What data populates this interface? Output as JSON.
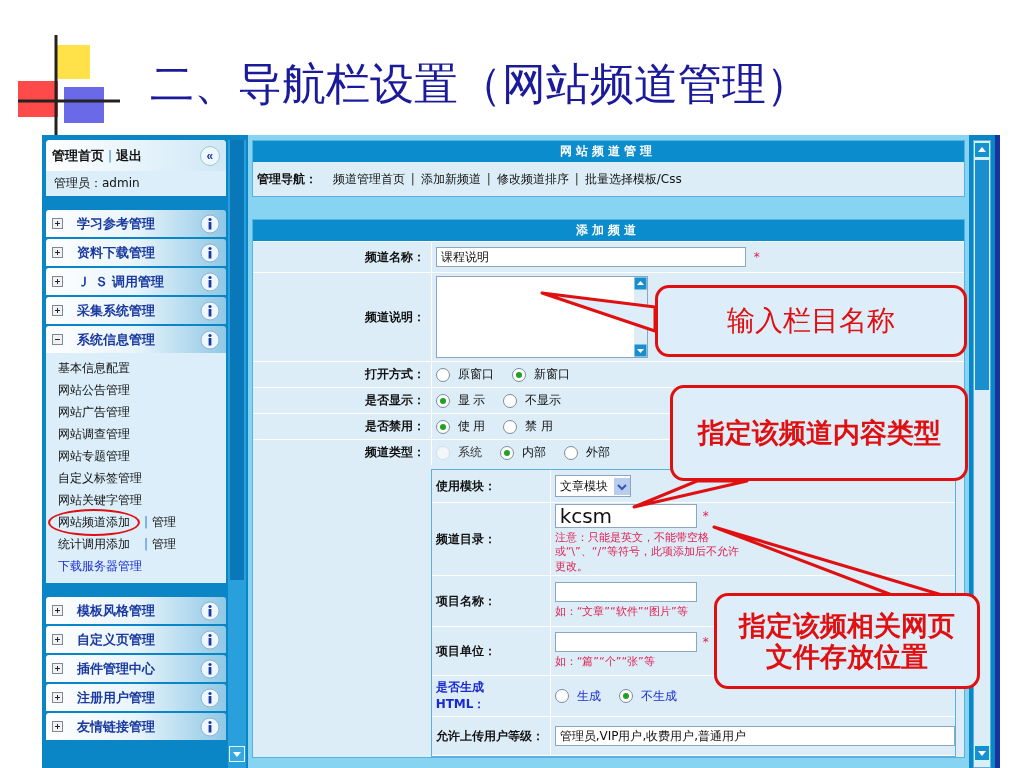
{
  "slide_title": "二、导航栏设置（网站频道管理）",
  "sidebar": {
    "home_link": "管理首页",
    "separator": "|",
    "logout_link": "退出",
    "collapse_glyph": "«",
    "admin_label": "管理员：admin",
    "groups": [
      {
        "label": "学习参考管理",
        "expanded": false
      },
      {
        "label": "资料下载管理",
        "expanded": false
      },
      {
        "label": "Ｊ Ｓ 调用管理",
        "expanded": false
      },
      {
        "label": "采集系统管理",
        "expanded": false
      },
      {
        "label": "系统信息管理",
        "expanded": true,
        "children": [
          {
            "label": "基本信息配置",
            "kind": "plain"
          },
          {
            "label": "网站公告管理",
            "kind": "plain"
          },
          {
            "label": "网站广告管理",
            "kind": "plain"
          },
          {
            "label": "网站调查管理",
            "kind": "plain"
          },
          {
            "label": "网站专题管理",
            "kind": "plain"
          },
          {
            "label": "自定义标签管理",
            "kind": "plain"
          },
          {
            "label": "网站关键字管理",
            "kind": "plain"
          },
          {
            "label": "网站频道添加",
            "kind": "pair",
            "extra": "管理",
            "highlighted": true
          },
          {
            "label": "统计调用添加",
            "kind": "pair",
            "extra": "管理",
            "highlighted": false
          },
          {
            "label": "下载服务器管理",
            "kind": "link"
          }
        ]
      },
      {
        "label": "模板风格管理",
        "expanded": false
      },
      {
        "label": "自定义页管理",
        "expanded": false
      },
      {
        "label": "插件管理中心",
        "expanded": false
      },
      {
        "label": "注册用户管理",
        "expanded": false
      },
      {
        "label": "友情链接管理",
        "expanded": false
      }
    ]
  },
  "panel_title": "网站频道管理",
  "nav": {
    "label": "管理导航：",
    "links": [
      "频道管理首页",
      "添加新频道",
      "修改频道排序",
      "批量选择模板/Css"
    ],
    "separator": "|"
  },
  "form": {
    "title": "添加频道",
    "name": {
      "label": "频道名称：",
      "value": "课程说明",
      "required_mark": "*"
    },
    "description": {
      "label": "频道说明："
    },
    "radio_rows": [
      {
        "label": "打开方式：",
        "options": [
          {
            "label": "原窗口",
            "selected": false,
            "disabled": false
          },
          {
            "label": "新窗口",
            "selected": true,
            "disabled": false
          }
        ]
      },
      {
        "label": "是否显示：",
        "options": [
          {
            "label": "显 示",
            "selected": true,
            "disabled": false
          },
          {
            "label": "不显示",
            "selected": false,
            "disabled": false
          }
        ]
      },
      {
        "label": "是否禁用：",
        "options": [
          {
            "label": "使 用",
            "selected": true,
            "disabled": false
          },
          {
            "label": "禁 用",
            "selected": false,
            "disabled": false
          }
        ]
      },
      {
        "label": "频道类型：",
        "options": [
          {
            "label": "系统",
            "selected": false,
            "disabled": true
          },
          {
            "label": "内部",
            "selected": true,
            "disabled": false
          },
          {
            "label": "外部",
            "selected": false,
            "disabled": false
          }
        ]
      }
    ],
    "module": {
      "label": "使用模块：",
      "value": "文章模块"
    },
    "directory": {
      "label": "频道目录：",
      "value": "kcsm",
      "required_mark": "*",
      "note": "注意：只能是英文，不能带空格或“\\”、“/”等符号，此项添加后不允许更改。"
    },
    "item_name": {
      "label": "项目名称：",
      "hint": "如：“文章”“软件”“图片”等"
    },
    "item_unit": {
      "label": "项目单位：",
      "required_mark": "*",
      "hint": "如：“篇”“个”“张”等"
    },
    "generate_html": {
      "label": "是否生成HTML：",
      "options": [
        {
          "label": "生成",
          "selected": false
        },
        {
          "label": "不生成",
          "selected": true
        }
      ]
    },
    "upload_levels": {
      "label": "允许上传用户等级：",
      "value": "管理员,VIP用户,收费用户,普通用户"
    }
  },
  "callouts": [
    {
      "kind": "name",
      "text": "输入栏目名称"
    },
    {
      "kind": "module",
      "text": "指定该频道内容类型"
    },
    {
      "kind": "directory",
      "text": "指定该频相关网页文件存放位置"
    }
  ]
}
